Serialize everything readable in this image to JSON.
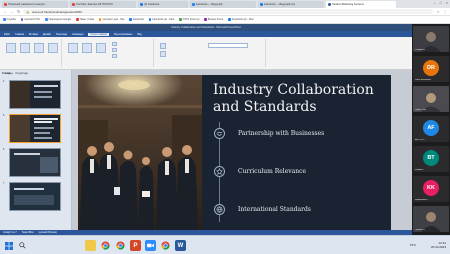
{
  "browser": {
    "tabs": [
      {
        "label": "Полезный университет выпуск",
        "color": "#e53935",
        "active": false
      },
      {
        "label": "YouTube: Занятие 65 ПОСТОЛ",
        "color": "#e53935",
        "active": false
      },
      {
        "label": "(2) Facebook",
        "color": "#1877f2",
        "active": false
      },
      {
        "label": "Facebook — Ведущий",
        "color": "#1877f2",
        "active": false
      },
      {
        "label": "Facebook — Ведущий стр",
        "color": "#1877f2",
        "active": false
      },
      {
        "label": "Student-Marketing Sections",
        "color": "#2b579a",
        "active": true
      }
    ],
    "url": "ness.pu2.Studentmarketingsection/0000",
    "bookmarks": [
      {
        "label": "Службы",
        "color": "#4285f4"
      },
      {
        "label": "teamtech Hub",
        "color": "#5c6bc0"
      },
      {
        "label": "Переводчик Google",
        "color": "#4285f4"
      },
      {
        "label": "Пакет слова",
        "color": "#e53935"
      },
      {
        "label": "интернет дня - Ник",
        "color": "#fb8c00"
      },
      {
        "label": "Facebook",
        "color": "#1877f2"
      },
      {
        "label": "Facebook (2) - Мои",
        "color": "#1877f2"
      },
      {
        "label": "TOP1 Кластер",
        "color": "#43a047"
      },
      {
        "label": "Бизнес блоги",
        "color": "#8e24aa"
      },
      {
        "label": "Facebook (2) - Мои",
        "color": "#1877f2"
      }
    ]
  },
  "powerpoint": {
    "window_title": "Industry Collaboration and Standards - Microsoft PowerPoint",
    "ribbon_tabs": [
      "Файл",
      "Главная",
      "Вставка",
      "Дизайн",
      "Переходы",
      "Анимация",
      "Показ слайдов",
      "Рецензирование",
      "Вид"
    ],
    "selected_tab": "Показ слайдов",
    "panel_tabs": [
      "Слайды",
      "Структура"
    ],
    "status_text": "Слайд 5 из 7",
    "status_theme": "Тема Office",
    "status_lang": "русский (Россия)"
  },
  "slide": {
    "title": "Industry Collaboration and Standards",
    "bullets": [
      {
        "text": "Partnership with Businesses",
        "icon": "handshake-icon"
      },
      {
        "text": "Curriculum Relevance",
        "icon": "star-icon"
      },
      {
        "text": "International Standards",
        "icon": "globe-icon"
      }
    ]
  },
  "participants": [
    {
      "name": "Спицин В",
      "initials": "",
      "color": "#5a5a5a",
      "video": true
    },
    {
      "name": "Daria Reshetova",
      "initials": "DR",
      "color": "#e8740c",
      "video": false
    },
    {
      "name": "Эзрат Саи",
      "initials": "",
      "color": "#5a5a5a",
      "video": true
    },
    {
      "name": "ANTON P",
      "initials": "AF",
      "color": "#1e88e5",
      "video": false
    },
    {
      "name": "Каймак Т",
      "initials": "BT",
      "color": "#00897b",
      "video": false
    },
    {
      "name": "Корнилова К",
      "initials": "KK",
      "color": "#e91e63",
      "video": false
    },
    {
      "name": "Павлов Л",
      "initials": "",
      "color": "#5a5a5a",
      "video": true
    }
  ],
  "taskbar": {
    "time": "12:31",
    "date": "20.04.2023",
    "lang": "РУС"
  }
}
